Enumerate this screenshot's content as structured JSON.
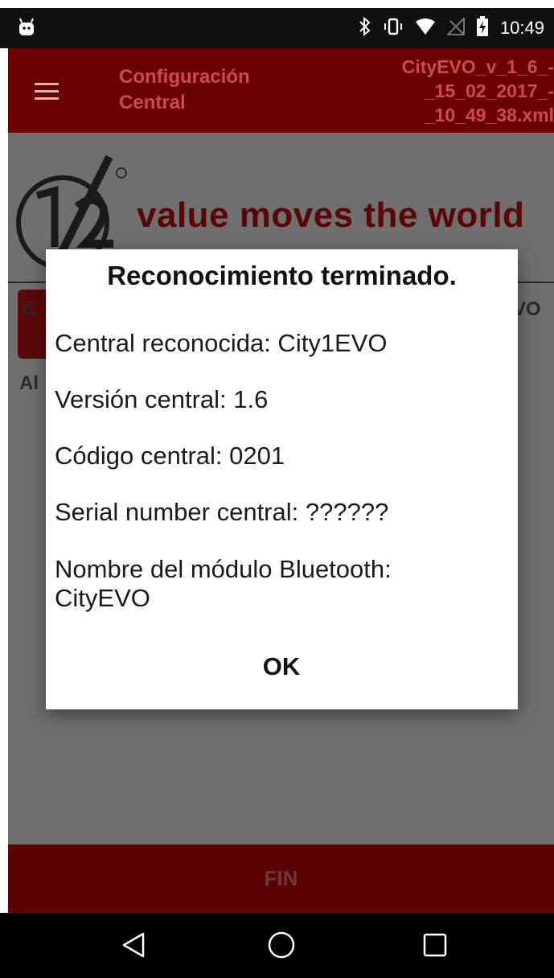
{
  "status_bar": {
    "time": "10:49",
    "icons": [
      "android-icon",
      "bluetooth-icon",
      "vibrate-icon",
      "wifi-icon",
      "no-signal-icon",
      "battery-charging-icon"
    ]
  },
  "app_bar": {
    "title": "Configuración\nCentral",
    "file_name": "CityEVO_v_1_6_-\n_15_02_2017_-\n_10_49_38.xml"
  },
  "background": {
    "slogan": "value moves the world",
    "frag_left_1": "C",
    "frag_left_2": "Al",
    "frag_right": "VO"
  },
  "dialog": {
    "title": "Reconocimiento terminado.",
    "lines": [
      "Central reconocida: City1EVO",
      "Versión central: 1.6",
      "Código central: 0201",
      "Serial number central: ??????",
      "Nombre del módulo Bluetooth:\nCityEVO"
    ],
    "ok_label": "OK"
  },
  "footer": {
    "fin_label": "FIN"
  },
  "nav_bar": {
    "buttons": [
      "back-icon",
      "home-icon",
      "recents-icon"
    ]
  },
  "colors": {
    "brand_red": "#6a0202",
    "dim_bg": "#6f6f6f",
    "dialog_bg": "#ffffff"
  }
}
